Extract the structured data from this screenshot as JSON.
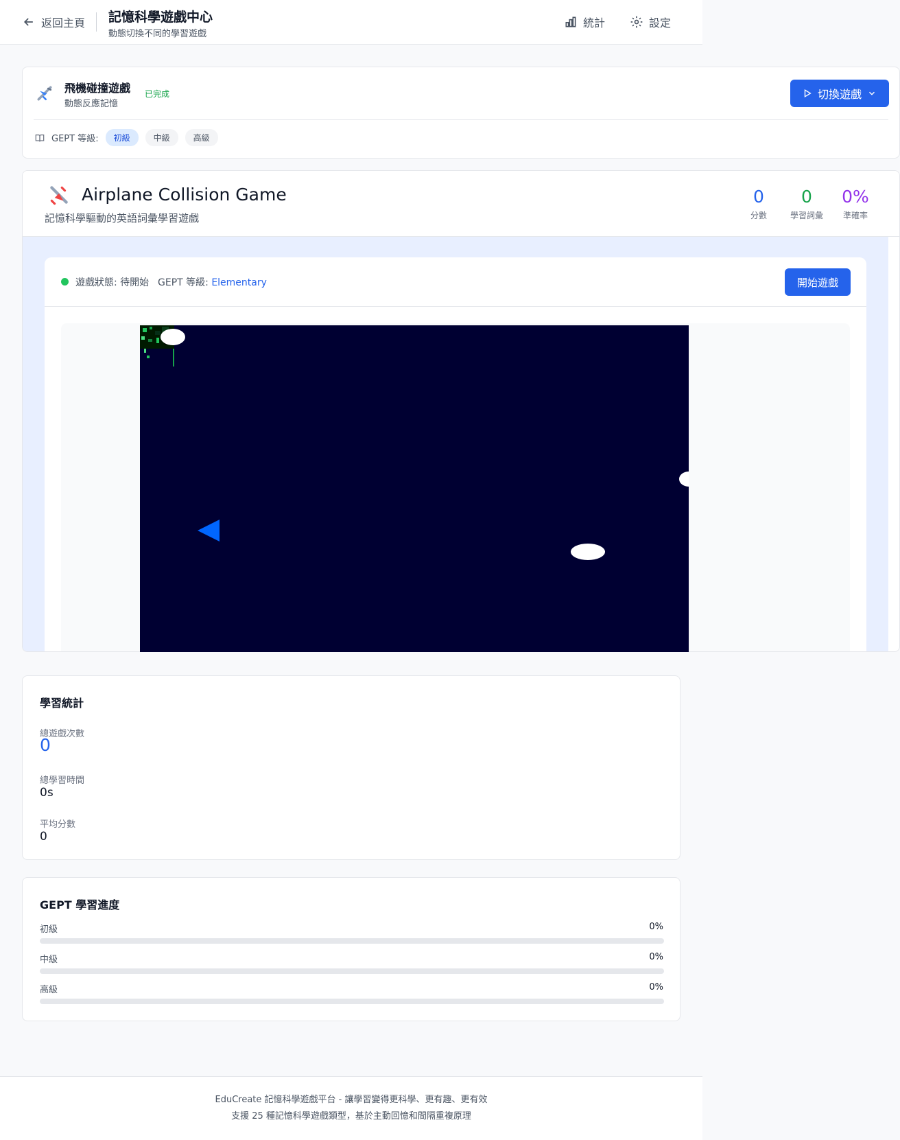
{
  "header": {
    "back_label": "返回主頁",
    "title": "記憶科學遊戲中心",
    "subtitle": "動態切換不同的學習遊戲",
    "stats_label": "統計",
    "settings_label": "設定"
  },
  "game_selector": {
    "name": "飛機碰撞遊戲",
    "description": "動態反應記憶",
    "status_badge": "已完成",
    "switch_label": "切換遊戲",
    "gept_label": "GEPT 等級:",
    "levels": [
      "初級",
      "中級",
      "高級"
    ],
    "active_level": "初級"
  },
  "game": {
    "title": "Airplane Collision Game",
    "subtitle": "記憶科學驅動的英語詞彙學習遊戲",
    "stats": [
      {
        "value": "0",
        "label": "分數",
        "color": "#2563eb"
      },
      {
        "value": "0",
        "label": "學習詞彙",
        "color": "#16a34a"
      },
      {
        "value": "0%",
        "label": "準確率",
        "color": "#9333ea"
      }
    ],
    "status_text": "遊戲狀態: 待開始",
    "gept_prefix": "GEPT 等級:",
    "gept_level": "Elementary",
    "start_label": "開始遊戲"
  },
  "learning_stats": {
    "title": "學習統計",
    "items": [
      {
        "label": "總遊戲次數",
        "value": "0"
      },
      {
        "label": "總學習時間",
        "value": "0s"
      },
      {
        "label": "平均分數",
        "value": "0"
      }
    ]
  },
  "gept_progress": {
    "title": "GEPT 學習進度",
    "levels": [
      {
        "label": "初級",
        "percent_text": "0%",
        "progress": 0
      },
      {
        "label": "中級",
        "percent_text": "0%",
        "progress": 0
      },
      {
        "label": "高級",
        "percent_text": "0%",
        "progress": 0
      }
    ]
  },
  "footer": {
    "line1": "EduCreate 記憶科學遊戲平台 - 讓學習變得更科學、更有趣、更有效",
    "line2": "支援 25 種記憶科學遊戲類型，基於主動回憶和間隔重複原理"
  },
  "colors": {
    "accent": "#2563eb",
    "canvas_bg": "#000032",
    "player": "#0066ff",
    "cloud": "#ffffff"
  }
}
